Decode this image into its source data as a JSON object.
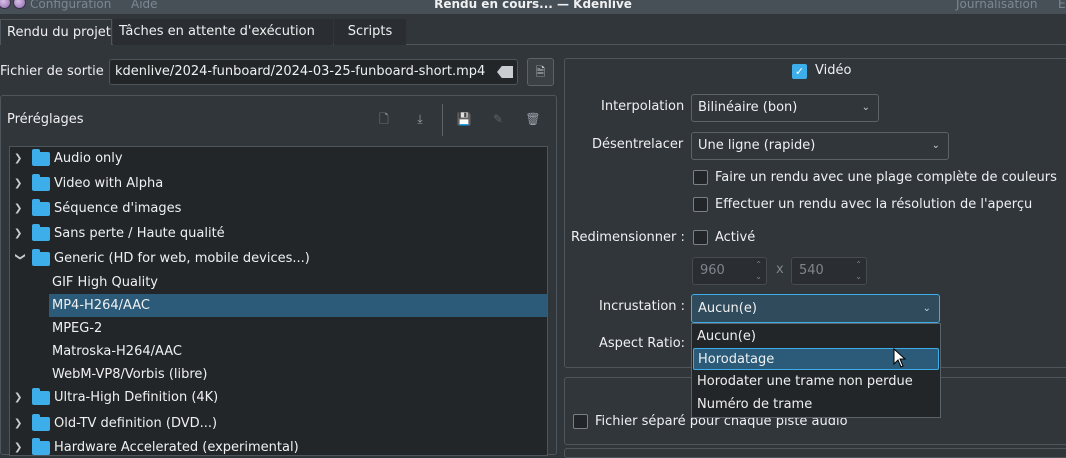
{
  "window": {
    "title": "Rendu en cours... — Kdenlive",
    "menu_left": [
      "Configuration",
      "Aide"
    ],
    "menu_right": "Journalisation"
  },
  "tabs": [
    {
      "label": "Rendu du projet",
      "active": true
    },
    {
      "label": "Tâches en attente d'exécution",
      "active": false
    },
    {
      "label": "Scripts",
      "active": false
    }
  ],
  "output": {
    "label": "Fichier de sortie",
    "value": "kdenlive/2024-funboard/2024-03-25-funboard-short.mp4"
  },
  "presets": {
    "label": "Préréglages",
    "items": [
      {
        "label": "Audio only",
        "type": "folder",
        "expanded": false
      },
      {
        "label": "Video with Alpha",
        "type": "folder",
        "expanded": false
      },
      {
        "label": "Séquence d'images",
        "type": "folder",
        "expanded": false
      },
      {
        "label": "Sans perte / Haute qualité",
        "type": "folder",
        "expanded": false
      },
      {
        "label": "Generic (HD for web, mobile devices...)",
        "type": "folder",
        "expanded": true
      },
      {
        "label": "GIF High Quality",
        "type": "item",
        "selected": false
      },
      {
        "label": "MP4-H264/AAC",
        "type": "item",
        "selected": true
      },
      {
        "label": "MPEG-2",
        "type": "item",
        "selected": false
      },
      {
        "label": "Matroska-H264/AAC",
        "type": "item",
        "selected": false
      },
      {
        "label": "WebM-VP8/Vorbis (libre)",
        "type": "item",
        "selected": false
      },
      {
        "label": "Ultra-High Definition (4K)",
        "type": "folder",
        "expanded": false
      },
      {
        "label": "Old-TV definition (DVD...)",
        "type": "folder",
        "expanded": false
      },
      {
        "label": "Hardware Accelerated (experimental)",
        "type": "folder",
        "expanded": false
      }
    ]
  },
  "video": {
    "checkbox_label": "Vidéo",
    "checked": true,
    "interpolation": {
      "label": "Interpolation",
      "value": "Bilinéaire (bon)"
    },
    "deinterlace": {
      "label": "Désentrelacer",
      "value": "Une ligne (rapide)"
    },
    "full_range": {
      "label": "Faire un rendu avec une plage complète de couleurs",
      "checked": false
    },
    "preview_res": {
      "label": "Effectuer un rendu avec la résolution de l'aperçu",
      "checked": false
    },
    "resize": {
      "label": "Redimensionner :",
      "checkbox_label": "Activé",
      "checked": false,
      "width": "960",
      "height": "540",
      "separator": "x"
    },
    "overlay": {
      "label": "Incrustation :",
      "value": "Aucun(e)",
      "options": [
        "Aucun(e)",
        "Horodatage",
        "Horodater une trame non perdue",
        "Numéro de trame"
      ],
      "highlighted": "Horodatage"
    },
    "aspect": {
      "label": "Aspect Ratio:"
    }
  },
  "audio": {
    "separate_tracks": {
      "label": "Fichier séparé pour chaque piste audio",
      "checked": false
    }
  },
  "colors": {
    "accent": "#3daee9",
    "selection": "#2b5b78",
    "background": "#31363b"
  }
}
